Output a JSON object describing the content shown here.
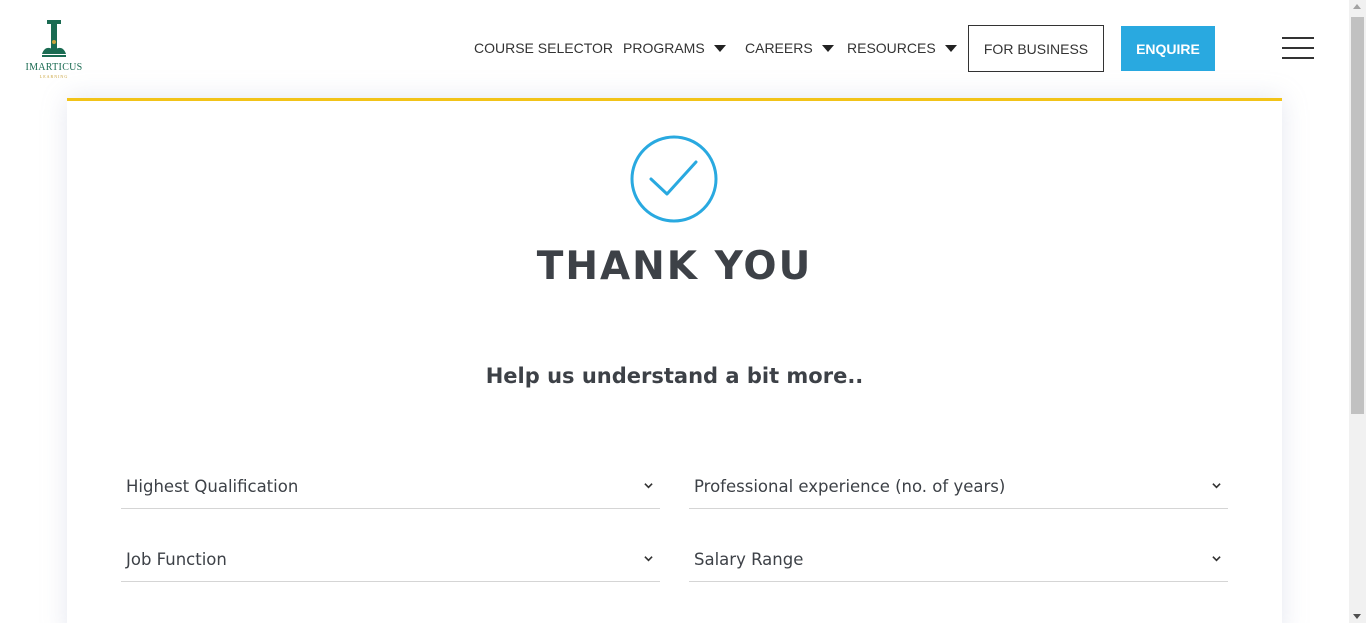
{
  "header": {
    "logo": {
      "name": "IMARTICUS",
      "sub": "LEARNING"
    },
    "nav": [
      {
        "label": "COURSE SELECTOR",
        "has_dropdown": false
      },
      {
        "label": "PROGRAMS",
        "has_dropdown": true
      },
      {
        "label": "CAREERS",
        "has_dropdown": true
      },
      {
        "label": "RESOURCES",
        "has_dropdown": true
      }
    ],
    "business_label": "FOR BUSINESS",
    "enquire_label": "ENQUIRE",
    "menu_icon": "hamburger-icon"
  },
  "main": {
    "success_icon": "check-circle-icon",
    "title": "THANK YOU",
    "subtitle": "Help us understand a bit more..",
    "selects": [
      {
        "label": "Highest Qualification"
      },
      {
        "label": "Professional experience (no. of years)"
      },
      {
        "label": "Job Function"
      },
      {
        "label": "Salary Range"
      }
    ]
  },
  "colors": {
    "accent": "#29a9e0",
    "brand_green": "#1a6b52",
    "card_top_border": "#f2c318",
    "text": "#3d4147"
  }
}
